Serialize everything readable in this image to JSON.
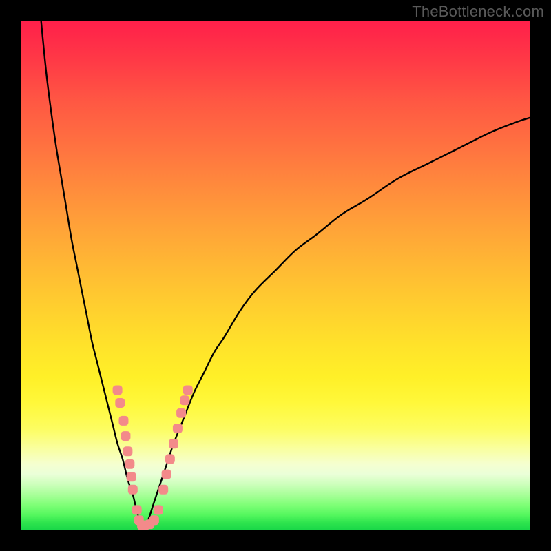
{
  "watermark": "TheBottleneck.com",
  "colors": {
    "frame": "#000000",
    "curve": "#000000",
    "marker_fill": "#f38a8a",
    "marker_stroke": "#e97878"
  },
  "chart_data": {
    "type": "line",
    "title": "",
    "xlabel": "",
    "ylabel": "",
    "xlim": [
      0,
      100
    ],
    "ylim": [
      0,
      100
    ],
    "grid": false,
    "note": "V-shaped bottleneck curve on a red-to-green gradient. No axis ticks or numeric labels are visible. Values are pixel-read estimates on a 0–100 normalized scale.",
    "series": [
      {
        "name": "left-branch",
        "x": [
          4,
          5,
          6,
          7,
          8,
          9,
          10,
          11,
          12,
          13,
          14,
          15,
          16,
          17,
          18,
          19,
          20,
          21,
          22,
          22.5,
          23,
          23.5,
          24
        ],
        "y": [
          100,
          90,
          82,
          75,
          69,
          63,
          57,
          52,
          47,
          42,
          37,
          33,
          29,
          25,
          21,
          17,
          14,
          10,
          7,
          5,
          3,
          1.5,
          0.5
        ]
      },
      {
        "name": "right-branch",
        "x": [
          24,
          25,
          26,
          27,
          28,
          29,
          30,
          32,
          34,
          36,
          38,
          40,
          43,
          46,
          50,
          54,
          58,
          63,
          68,
          74,
          80,
          86,
          92,
          97,
          100
        ],
        "y": [
          0.5,
          2,
          5,
          8,
          11,
          14,
          17,
          22,
          27,
          31,
          35,
          38,
          43,
          47,
          51,
          55,
          58,
          62,
          65,
          69,
          72,
          75,
          78,
          80,
          81
        ]
      }
    ],
    "markers": {
      "name": "sample-points",
      "shape": "rounded-square",
      "points_xy": [
        [
          19.0,
          27.5
        ],
        [
          19.5,
          25.0
        ],
        [
          20.2,
          21.5
        ],
        [
          20.6,
          18.5
        ],
        [
          21.0,
          15.5
        ],
        [
          21.4,
          13.0
        ],
        [
          21.7,
          10.5
        ],
        [
          22.0,
          8.0
        ],
        [
          22.8,
          4.0
        ],
        [
          23.2,
          2.0
        ],
        [
          23.8,
          1.0
        ],
        [
          24.4,
          1.0
        ],
        [
          25.3,
          1.2
        ],
        [
          26.2,
          2.0
        ],
        [
          27.0,
          4.0
        ],
        [
          28.0,
          8.0
        ],
        [
          28.6,
          11.0
        ],
        [
          29.3,
          14.0
        ],
        [
          30.0,
          17.0
        ],
        [
          30.8,
          20.0
        ],
        [
          31.5,
          23.0
        ],
        [
          32.2,
          25.5
        ],
        [
          32.8,
          27.5
        ]
      ]
    }
  }
}
